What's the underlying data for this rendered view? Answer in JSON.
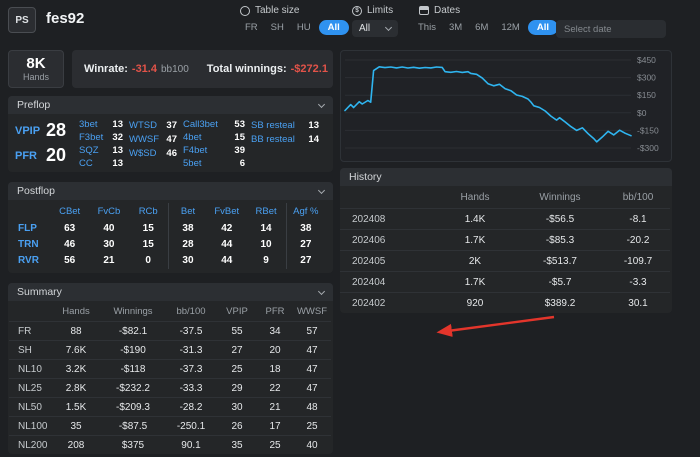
{
  "header": {
    "logo": "PS",
    "username": "fes92",
    "table_size": {
      "label": "Table size",
      "options": [
        "FR",
        "SH",
        "HU",
        "All"
      ],
      "active": "All"
    },
    "limits": {
      "label": "Limits",
      "value": "All"
    },
    "dates": {
      "label": "Dates",
      "options": [
        "This",
        "3M",
        "6M",
        "12M",
        "All"
      ],
      "active": "All",
      "date_placeholder": "Select date"
    }
  },
  "icons": {
    "dollar": "$"
  },
  "overview": {
    "hands_value": "8K",
    "hands_label": "Hands",
    "winrate_label": "Winrate:",
    "winrate_value": "-31.4",
    "winrate_unit": "bb100",
    "winnings_label": "Total winnings:",
    "winnings_value": "-$272.1"
  },
  "preflop": {
    "title": "Preflop",
    "big_stats": [
      {
        "label": "VPIP",
        "value": "28"
      },
      {
        "label": "PFR",
        "value": "20"
      }
    ],
    "stat_groups": [
      [
        {
          "label": "3bet",
          "value": "13"
        },
        {
          "label": "F3bet",
          "value": "32"
        },
        {
          "label": "SQZ",
          "value": "13"
        },
        {
          "label": "CC",
          "value": "13"
        }
      ],
      [
        {
          "label": "WTSD",
          "value": "37"
        },
        {
          "label": "WWSF",
          "value": "47"
        },
        {
          "label": "W$SD",
          "value": "46"
        }
      ],
      [
        {
          "label": "Call3bet",
          "value": "53"
        },
        {
          "label": "4bet",
          "value": "15"
        },
        {
          "label": "F4bet",
          "value": "39"
        },
        {
          "label": "5bet",
          "value": "6"
        }
      ],
      [
        {
          "label": "SB resteal",
          "value": "13"
        },
        {
          "label": "BB resteal",
          "value": "14"
        }
      ]
    ]
  },
  "postflop": {
    "title": "Postflop",
    "columns": [
      "CBet",
      "FvCb",
      "RCb",
      "Bet",
      "FvBet",
      "RBet",
      "Agf %"
    ],
    "rows": [
      {
        "label": "FLP",
        "values": [
          "63",
          "40",
          "15",
          "38",
          "42",
          "14",
          "38"
        ]
      },
      {
        "label": "TRN",
        "values": [
          "46",
          "30",
          "15",
          "28",
          "44",
          "10",
          "27"
        ]
      },
      {
        "label": "RVR",
        "values": [
          "56",
          "21",
          "0",
          "30",
          "44",
          "9",
          "27"
        ]
      }
    ]
  },
  "summary": {
    "title": "Summary",
    "columns": [
      "",
      "Hands",
      "Winnings",
      "bb/100",
      "VPIP",
      "PFR",
      "WWSF"
    ],
    "rows": [
      {
        "label": "FR",
        "hands": "88",
        "winnings": "-$82.1",
        "bb100": "-37.5",
        "vpip": "55",
        "pfr": "34",
        "wwsf": "57"
      },
      {
        "label": "SH",
        "hands": "7.6K",
        "winnings": "-$190",
        "bb100": "-31.3",
        "vpip": "27",
        "pfr": "20",
        "wwsf": "47"
      },
      {
        "label": "NL10",
        "hands": "3.2K",
        "winnings": "-$118",
        "bb100": "-37.3",
        "vpip": "25",
        "pfr": "18",
        "wwsf": "47"
      },
      {
        "label": "NL25",
        "hands": "2.8K",
        "winnings": "-$232.2",
        "bb100": "-33.3",
        "vpip": "29",
        "pfr": "22",
        "wwsf": "47"
      },
      {
        "label": "NL50",
        "hands": "1.5K",
        "winnings": "-$209.3",
        "bb100": "-28.2",
        "vpip": "30",
        "pfr": "21",
        "wwsf": "48"
      },
      {
        "label": "NL100",
        "hands": "35",
        "winnings": "-$87.5",
        "bb100": "-250.1",
        "vpip": "26",
        "pfr": "17",
        "wwsf": "25"
      },
      {
        "label": "NL200",
        "hands": "208",
        "winnings": "$375",
        "bb100": "90.1",
        "vpip": "35",
        "pfr": "25",
        "wwsf": "40"
      }
    ]
  },
  "history": {
    "title": "History",
    "columns": [
      "",
      "Hands",
      "Winnings",
      "bb/100"
    ],
    "rows": [
      {
        "label": "202408",
        "hands": "1.4K",
        "winnings": "-$56.5",
        "bb100": "-8.1"
      },
      {
        "label": "202406",
        "hands": "1.7K",
        "winnings": "-$85.3",
        "bb100": "-20.2"
      },
      {
        "label": "202405",
        "hands": "2K",
        "winnings": "-$513.7",
        "bb100": "-109.7"
      },
      {
        "label": "202404",
        "hands": "1.7K",
        "winnings": "-$5.7",
        "bb100": "-3.3"
      },
      {
        "label": "202402",
        "hands": "920",
        "winnings": "$389.2",
        "bb100": "30.1"
      }
    ]
  },
  "chart_data": {
    "type": "line",
    "ytick_labels": [
      "$450",
      "$300",
      "$150",
      "$0",
      "-$150",
      "-$300"
    ],
    "yticks": [
      450,
      300,
      150,
      0,
      -150,
      -300
    ],
    "x_range": [
      0,
      100
    ],
    "series": [
      {
        "name": "winnings",
        "color": "#2fb5f0",
        "points": [
          [
            0,
            20
          ],
          [
            2,
            70
          ],
          [
            3,
            45
          ],
          [
            5,
            95
          ],
          [
            6,
            75
          ],
          [
            8,
            105
          ],
          [
            9,
            90
          ],
          [
            10,
            360
          ],
          [
            12,
            392
          ],
          [
            14,
            385
          ],
          [
            16,
            390
          ],
          [
            18,
            383
          ],
          [
            20,
            390
          ],
          [
            22,
            382
          ],
          [
            24,
            388
          ],
          [
            26,
            380
          ],
          [
            28,
            386
          ],
          [
            30,
            383
          ],
          [
            32,
            390
          ],
          [
            34,
            387
          ],
          [
            35,
            350
          ],
          [
            37,
            345
          ],
          [
            39,
            352
          ],
          [
            41,
            344
          ],
          [
            43,
            350
          ],
          [
            44,
            336
          ],
          [
            46,
            328
          ],
          [
            48,
            296
          ],
          [
            50,
            248
          ],
          [
            52,
            230
          ],
          [
            54,
            243
          ],
          [
            56,
            205
          ],
          [
            58,
            188
          ],
          [
            60,
            152
          ],
          [
            62,
            140
          ],
          [
            64,
            118
          ],
          [
            65,
            92
          ],
          [
            66,
            60
          ],
          [
            68,
            45
          ],
          [
            70,
            15
          ],
          [
            72,
            -28
          ],
          [
            74,
            -62
          ],
          [
            75,
            -42
          ],
          [
            77,
            -78
          ],
          [
            79,
            -118
          ],
          [
            81,
            -150
          ],
          [
            83,
            -128
          ],
          [
            85,
            -178
          ],
          [
            87,
            -220
          ],
          [
            88,
            -248
          ],
          [
            90,
            -205
          ],
          [
            92,
            -158
          ],
          [
            94,
            -188
          ],
          [
            96,
            -148
          ],
          [
            98,
            -175
          ],
          [
            100,
            -195
          ]
        ]
      }
    ]
  },
  "colors": {
    "accent": "#4aa0f2",
    "active_pill": "#2f92f0",
    "negative": "#e25349",
    "positive": "#43b34d",
    "chart_line": "#2fb5f0"
  },
  "annotation": {
    "type": "arrow",
    "color": "#e3352b"
  }
}
